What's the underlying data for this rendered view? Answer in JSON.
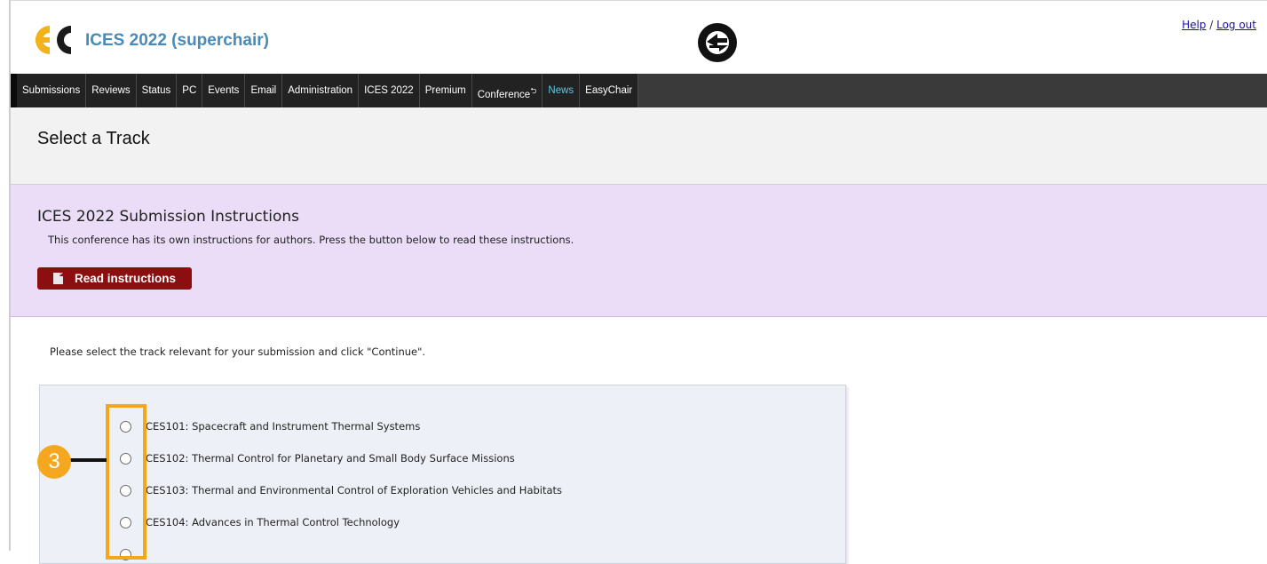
{
  "header": {
    "app_title": "ICES 2022 (superchair)",
    "help_link": "Help",
    "separator": " / ",
    "logout_link": "Log out"
  },
  "menu": {
    "items": [
      "Submissions",
      "Reviews",
      "Status",
      "PC",
      "Events",
      "Email",
      "Administration",
      "ICES 2022",
      "Premium",
      "Conference",
      "News",
      "EasyChair"
    ]
  },
  "page": {
    "title": "Select a Track"
  },
  "instructions": {
    "title": "ICES 2022 Submission Instructions",
    "text": "This conference has its own instructions for authors. Press the button below to read these instructions.",
    "button_label": "Read instructions"
  },
  "prompt": "Please select the track relevant for your submission and click \"Continue\".",
  "tracks": [
    "CES101: Spacecraft and Instrument Thermal Systems",
    "CES102: Thermal Control for Planetary and Small Body Surface Missions",
    "CES103: Thermal and Environmental Control of Exploration Vehicles and Habitats",
    "CES104: Advances in Thermal Control Technology"
  ],
  "callout": {
    "number": "3"
  },
  "colors": {
    "menu_bg": "#222222",
    "news": "#5fc8e8",
    "button": "#8b0f10",
    "instructions_bg": "#ebdcf7",
    "callout": "#f5a81f"
  }
}
